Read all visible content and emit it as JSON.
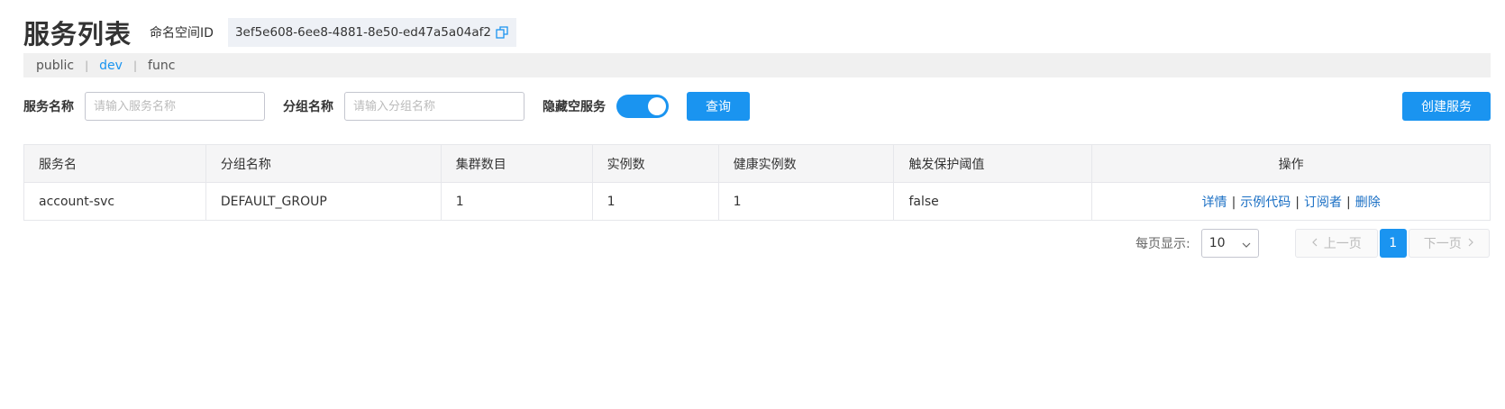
{
  "header": {
    "title": "服务列表",
    "namespace_label": "命名空间ID",
    "namespace_id": "3ef5e608-6ee8-4881-8e50-ed47a5a04af2"
  },
  "namespaces": [
    {
      "label": "public",
      "active": false
    },
    {
      "label": "dev",
      "active": true
    },
    {
      "label": "func",
      "active": false
    }
  ],
  "namespace_separator": "|",
  "filter": {
    "service_name_label": "服务名称",
    "service_name_placeholder": "请输入服务名称",
    "group_name_label": "分组名称",
    "group_name_placeholder": "请输入分组名称",
    "hide_empty_label": "隐藏空服务",
    "hide_empty_on": true,
    "query_button": "查询",
    "create_button": "创建服务"
  },
  "table": {
    "columns": [
      "服务名",
      "分组名称",
      "集群数目",
      "实例数",
      "健康实例数",
      "触发保护阈值",
      "操作"
    ],
    "rows": [
      {
        "service": "account-svc",
        "group": "DEFAULT_GROUP",
        "clusters": "1",
        "instances": "1",
        "healthy": "1",
        "threshold": "false"
      }
    ],
    "actions": [
      "详情",
      "示例代码",
      "订阅者",
      "删除"
    ],
    "action_separator": "|"
  },
  "pagination": {
    "page_size_label": "每页显示:",
    "page_size": "10",
    "prev": "上一页",
    "current_page": "1",
    "next": "下一页"
  },
  "colors": {
    "accent": "#1a94f0",
    "link": "#1a6fc4"
  }
}
